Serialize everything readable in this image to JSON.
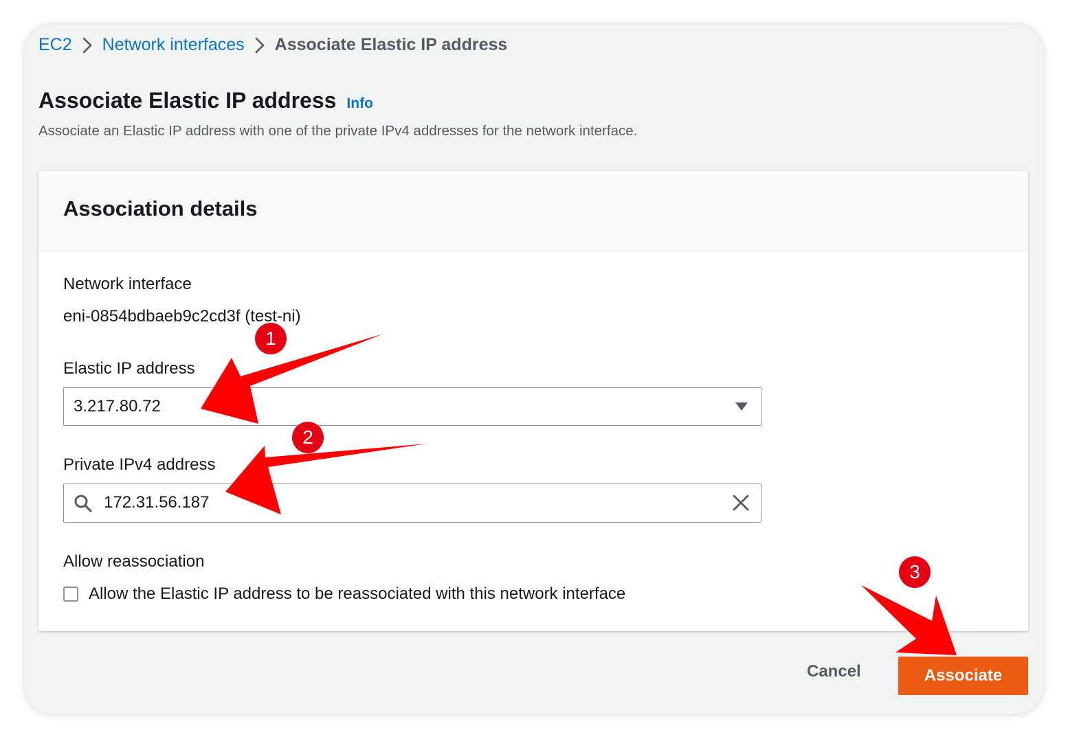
{
  "breadcrumb": {
    "items": [
      "EC2",
      "Network interfaces"
    ],
    "current": "Associate Elastic IP address"
  },
  "header": {
    "title": "Associate Elastic IP address",
    "info_link": "Info",
    "description": "Associate an Elastic IP address with one of the private IPv4 addresses for the network interface."
  },
  "panel": {
    "title": "Association details",
    "network_interface": {
      "label": "Network interface",
      "value": "eni-0854bdbaeb9c2cd3f (test-ni)"
    },
    "elastic_ip": {
      "label": "Elastic IP address",
      "value": "3.217.80.72"
    },
    "private_ipv4": {
      "label": "Private IPv4 address",
      "value": "172.31.56.187"
    },
    "reassociation": {
      "label": "Allow reassociation",
      "checkbox_label": "Allow the Elastic IP address to be reassociated with this network interface",
      "checked": false
    }
  },
  "actions": {
    "cancel_label": "Cancel",
    "associate_label": "Associate"
  },
  "annotations": {
    "step_1": "1",
    "step_2": "2",
    "step_3": "3",
    "color": "#e60012"
  },
  "colors": {
    "link": "#0972d3",
    "primary_button": "#ec5b12",
    "background": "#f2f3f3"
  },
  "icons": {
    "separator": "chevron-right-icon",
    "dropdown": "caret-down-icon",
    "search": "search-icon",
    "clear": "close-icon"
  }
}
